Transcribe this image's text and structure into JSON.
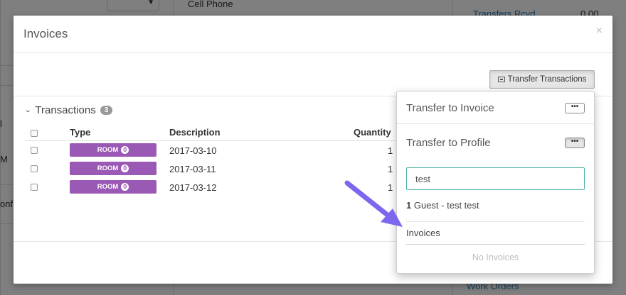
{
  "background": {
    "left_items": [
      "l",
      "M",
      "onf"
    ],
    "cell_phone": "Cell Phone",
    "transfers_rcvd": "Transfers Rcvd",
    "transfers_amount": "0.00",
    "work_orders": "Work Orders"
  },
  "modal": {
    "title": "Invoices",
    "close": "×",
    "transfer_button": "Transfer Transactions",
    "section": {
      "title": "Transactions",
      "count": "3"
    },
    "table": {
      "headers": [
        "Type",
        "Description",
        "Quantity"
      ],
      "rows": [
        {
          "type": "ROOM",
          "badge": "0",
          "description": "2017-03-10",
          "quantity": "1"
        },
        {
          "type": "ROOM",
          "badge": "0",
          "description": "2017-03-11",
          "quantity": "1"
        },
        {
          "type": "ROOM",
          "badge": "0",
          "description": "2017-03-12",
          "quantity": "1"
        }
      ]
    }
  },
  "popover": {
    "transfer_to_invoice": "Transfer to Invoice",
    "transfer_to_profile": "Transfer to Profile",
    "dots": "•••",
    "search_value": "test",
    "result_count": "1",
    "result_text": "Guest - test test",
    "invoices_label": "Invoices",
    "no_invoices": "No Invoices"
  },
  "colors": {
    "room_badge": "#9b59b6",
    "input_focus": "#4fb3a5",
    "arrow": "#7b68ee"
  }
}
